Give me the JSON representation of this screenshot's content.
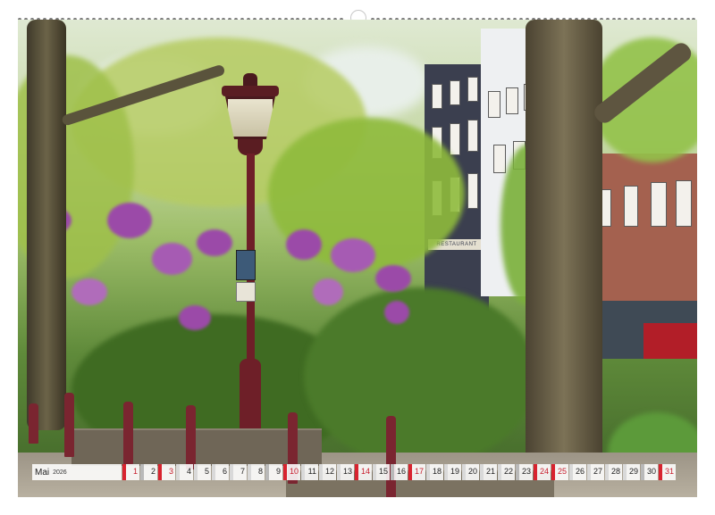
{
  "calendar": {
    "month": "Mai",
    "year": "2026",
    "days": [
      {
        "n": "1",
        "kind": "holiday"
      },
      {
        "n": "2",
        "kind": "sat"
      },
      {
        "n": "3",
        "kind": "sun"
      },
      {
        "n": "4",
        "kind": "weekday"
      },
      {
        "n": "5",
        "kind": "weekday"
      },
      {
        "n": "6",
        "kind": "weekday"
      },
      {
        "n": "7",
        "kind": "weekday"
      },
      {
        "n": "8",
        "kind": "weekday"
      },
      {
        "n": "9",
        "kind": "sat"
      },
      {
        "n": "10",
        "kind": "sun"
      },
      {
        "n": "11",
        "kind": "weekday"
      },
      {
        "n": "12",
        "kind": "weekday"
      },
      {
        "n": "13",
        "kind": "weekday"
      },
      {
        "n": "14",
        "kind": "holiday"
      },
      {
        "n": "15",
        "kind": "weekday"
      },
      {
        "n": "16",
        "kind": "sat"
      },
      {
        "n": "17",
        "kind": "sun"
      },
      {
        "n": "18",
        "kind": "weekday"
      },
      {
        "n": "19",
        "kind": "weekday"
      },
      {
        "n": "20",
        "kind": "weekday"
      },
      {
        "n": "21",
        "kind": "weekday"
      },
      {
        "n": "22",
        "kind": "weekday"
      },
      {
        "n": "23",
        "kind": "sat"
      },
      {
        "n": "24",
        "kind": "sun"
      },
      {
        "n": "25",
        "kind": "holiday"
      },
      {
        "n": "26",
        "kind": "weekday"
      },
      {
        "n": "27",
        "kind": "weekday"
      },
      {
        "n": "28",
        "kind": "weekday"
      },
      {
        "n": "29",
        "kind": "weekday"
      },
      {
        "n": "30",
        "kind": "sat"
      },
      {
        "n": "31",
        "kind": "sun"
      }
    ]
  },
  "photo": {
    "sign_text": "RESTAURANT"
  },
  "colors": {
    "sunday": "#d8232f",
    "holiday_text": "#c81e2d",
    "lamp": "#6e1f28",
    "lilac": "#9b4aa8"
  }
}
